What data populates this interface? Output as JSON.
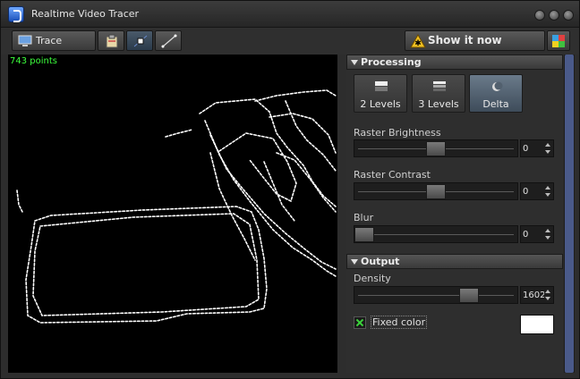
{
  "window": {
    "title": "Realtime Video Tracer"
  },
  "toolbar": {
    "trace_label": "Trace",
    "show_label": "Show it now"
  },
  "canvas": {
    "points_label": "743 points"
  },
  "processing": {
    "header": "Processing",
    "modes": [
      {
        "label": "2 Levels",
        "active": false
      },
      {
        "label": "3 Levels",
        "active": false
      },
      {
        "label": "Delta",
        "active": true
      }
    ],
    "raster_brightness": {
      "label": "Raster Brightness",
      "value": "0",
      "level": 0.5
    },
    "raster_contrast": {
      "label": "Raster Contrast",
      "value": "0",
      "level": 0.5
    },
    "blur": {
      "label": "Blur",
      "value": "0",
      "level": 0.0
    }
  },
  "output": {
    "header": "Output",
    "density": {
      "label": "Density",
      "value": "1602",
      "level": 0.73
    },
    "fixed_color": {
      "label": "Fixed color",
      "checked": true,
      "color": "#ffffff"
    }
  },
  "colors": {
    "accent": "#3cff3c",
    "scrollbar": "#4a5a8a",
    "active_button": "#5a6a7a",
    "canvas_bg": "#000000",
    "trace": "#ffffff"
  }
}
